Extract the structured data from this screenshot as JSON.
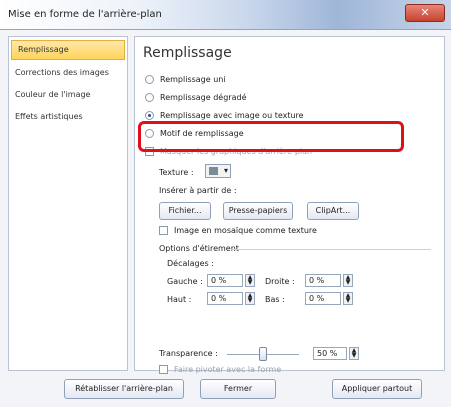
{
  "window": {
    "title": "Mise en forme de l'arrière-plan",
    "close_glyph": "✕"
  },
  "nav": {
    "items": [
      {
        "label": "Remplissage",
        "active": true
      },
      {
        "label": "Corrections des images",
        "active": false
      },
      {
        "label": "Couleur de l'image",
        "active": false
      },
      {
        "label": "Effets artistiques",
        "active": false
      }
    ]
  },
  "content": {
    "heading": "Remplissage",
    "options": [
      {
        "label": "Remplissage uni",
        "selected": false
      },
      {
        "label": "Remplissage dégradé",
        "selected": false
      },
      {
        "label": "Remplissage avec image ou texture",
        "selected": true
      },
      {
        "label": "Motif de remplissage",
        "selected": false
      }
    ],
    "hide_background_label": "Masquer les graphiques d'arrière-plan",
    "texture_label": "Texture :",
    "insert_from_label": "Insérer à partir de :",
    "buttons": {
      "file": "Fichier...",
      "clipboard": "Presse-papiers",
      "clipart": "ClipArt..."
    },
    "tile_label": "Image en mosaïque comme texture",
    "stretch_options_label": "Options d'étirement",
    "offsets_label": "Décalages :",
    "left_label": "Gauche :",
    "left_value": "0 %",
    "right_label": "Droite :",
    "right_value": "0 %",
    "top_label": "Haut :",
    "top_value": "0 %",
    "bottom_label": "Bas :",
    "bottom_value": "0 %",
    "transparency_label": "Transparence :",
    "transparency_value": "50 %",
    "transparency_level": 0.5,
    "rotate_with_shape_label": "Faire pivoter avec la forme"
  },
  "footer": {
    "reset": "Rétablisser l'arrière-plan",
    "close": "Fermer",
    "apply_all": "Appliquer partout"
  },
  "colors": {
    "highlight": "#e0101a",
    "nav_active": "#ffd35c"
  }
}
